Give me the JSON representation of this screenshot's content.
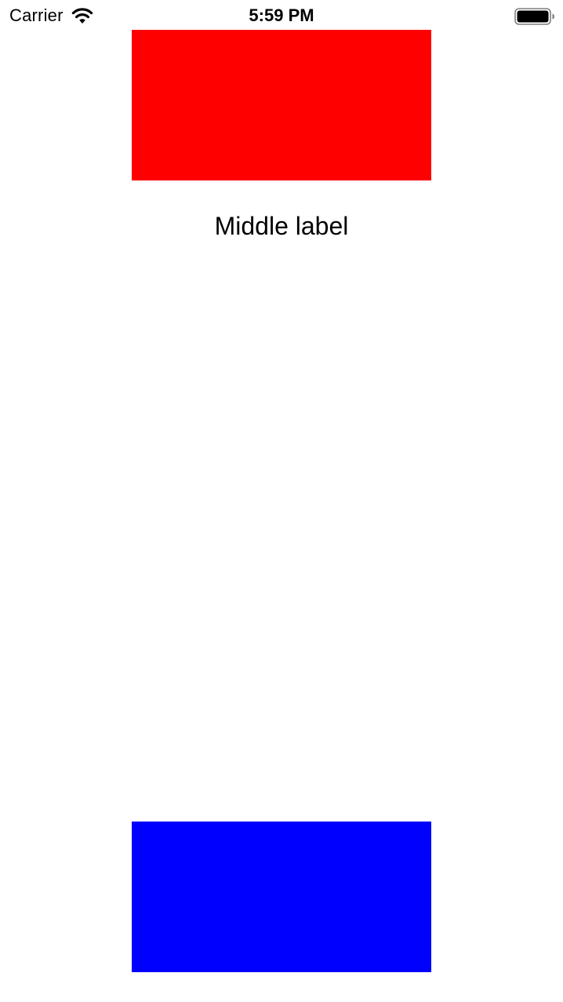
{
  "status_bar": {
    "carrier": "Carrier",
    "time": "5:59 PM",
    "wifi_icon": "wifi-icon",
    "battery_icon": "battery-full-icon"
  },
  "content": {
    "top_box_color": "#ff0000",
    "middle_label": "Middle label",
    "bottom_box_color": "#0000ff"
  }
}
